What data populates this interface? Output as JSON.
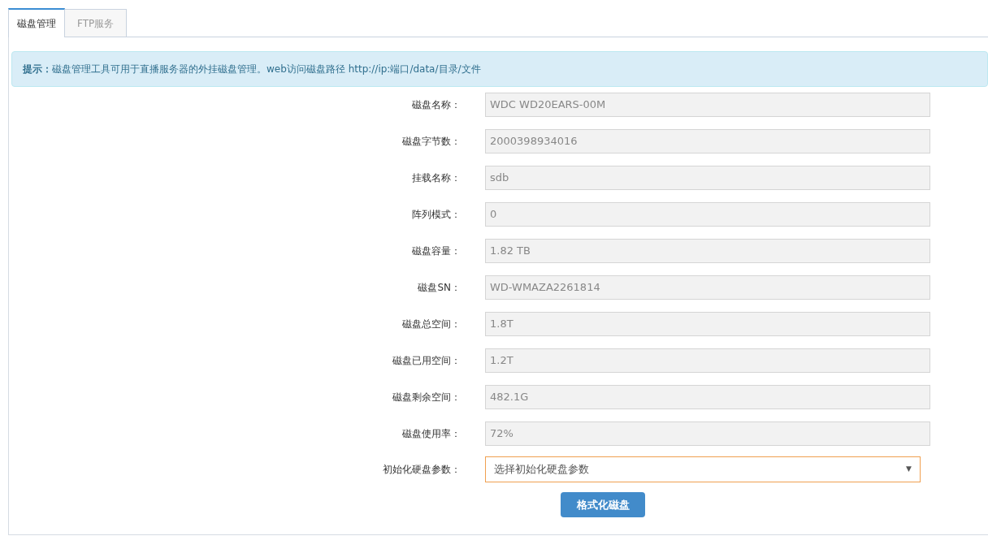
{
  "tabs": [
    {
      "label": "磁盘管理",
      "selected": true
    },
    {
      "label": "FTP服务",
      "selected": false
    }
  ],
  "notice": "**提示：**磁盘管理工具可用于直播服务器的外挂磁盘管理。web访问磁盘路径 http://ip:端口/data/目录/文件",
  "fields": [
    {
      "label": "磁盘名称：",
      "value": "WDC WD20EARS-00M"
    },
    {
      "label": "磁盘字节数：",
      "value": "2000398934016"
    },
    {
      "label": "挂载名称：",
      "value": "sdb"
    },
    {
      "label": "阵列模式：",
      "value": "0"
    },
    {
      "label": "磁盘容量：",
      "value": "1.82 TB"
    },
    {
      "label": "磁盘SN：",
      "value": "WD-WMAZA2261814"
    },
    {
      "label": "磁盘总空间：",
      "value": "1.8T"
    },
    {
      "label": "磁盘已用空间：",
      "value": "1.2T"
    },
    {
      "label": "磁盘剩余空间：",
      "value": "482.1G"
    },
    {
      "label": "磁盘使用率：",
      "value": "72%"
    }
  ],
  "select": {
    "label": "初始化硬盘参数：",
    "value": "选择初始化硬盘参数",
    "arrow": "▼"
  },
  "button": "格式化磁盘"
}
